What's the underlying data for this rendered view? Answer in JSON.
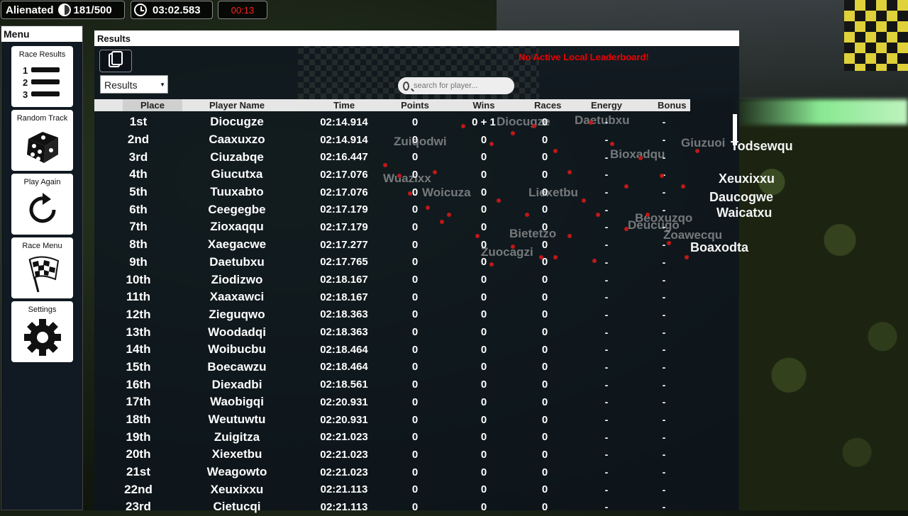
{
  "hud": {
    "player_name": "Alienated",
    "progress": "181/500",
    "race_time": "03:02.583",
    "countdown": "00:13"
  },
  "menu": {
    "title": "Menu",
    "buttons": [
      {
        "label": "Race Results",
        "icon": "podium-list-icon"
      },
      {
        "label": "Random Track",
        "icon": "dice-icon"
      },
      {
        "label": "Play Again",
        "icon": "refresh-icon"
      },
      {
        "label": "Race Menu",
        "icon": "checkered-flag-icon"
      },
      {
        "label": "Settings",
        "icon": "gear-icon"
      }
    ]
  },
  "results": {
    "title": "Results",
    "warning": "No Active Local Leaderboard!",
    "dropdown_value": "Results",
    "search_placeholder": "search for player...",
    "columns": [
      "Place",
      "Player Name",
      "Time",
      "Points",
      "Wins",
      "Races",
      "Energy",
      "Bonus"
    ],
    "rows": [
      [
        "1st",
        "Diocugze",
        "02:14.914",
        "0",
        "0 + 1",
        "0",
        "-",
        "-"
      ],
      [
        "2nd",
        "Caaxuxzo",
        "02:14.914",
        "0",
        "0",
        "0",
        "-",
        "-"
      ],
      [
        "3rd",
        "Ciuzabqe",
        "02:16.447",
        "0",
        "0",
        "0",
        "-",
        "-"
      ],
      [
        "4th",
        "Giucutxa",
        "02:17.076",
        "0",
        "0",
        "0",
        "-",
        "-"
      ],
      [
        "5th",
        "Tuuxabto",
        "02:17.076",
        "0",
        "0",
        "0",
        "-",
        "-"
      ],
      [
        "6th",
        "Ceegegbe",
        "02:17.179",
        "0",
        "0",
        "0",
        "-",
        "-"
      ],
      [
        "7th",
        "Zioxaqqu",
        "02:17.179",
        "0",
        "0",
        "0",
        "-",
        "-"
      ],
      [
        "8th",
        "Xaegacwe",
        "02:17.277",
        "0",
        "0",
        "0",
        "-",
        "-"
      ],
      [
        "9th",
        "Daetubxu",
        "02:17.765",
        "0",
        "0",
        "0",
        "-",
        "-"
      ],
      [
        "10th",
        "Ziodizwo",
        "02:18.167",
        "0",
        "0",
        "0",
        "-",
        "-"
      ],
      [
        "11th",
        "Xaaxawci",
        "02:18.167",
        "0",
        "0",
        "0",
        "-",
        "-"
      ],
      [
        "12th",
        "Zieguqwo",
        "02:18.363",
        "0",
        "0",
        "0",
        "-",
        "-"
      ],
      [
        "13th",
        "Woodadqi",
        "02:18.363",
        "0",
        "0",
        "0",
        "-",
        "-"
      ],
      [
        "14th",
        "Woibucbu",
        "02:18.464",
        "0",
        "0",
        "0",
        "-",
        "-"
      ],
      [
        "15th",
        "Boecawzu",
        "02:18.464",
        "0",
        "0",
        "0",
        "-",
        "-"
      ],
      [
        "16th",
        "Diexadbi",
        "02:18.561",
        "0",
        "0",
        "0",
        "-",
        "-"
      ],
      [
        "17th",
        "Waobigqi",
        "02:20.931",
        "0",
        "0",
        "0",
        "-",
        "-"
      ],
      [
        "18th",
        "Weutuwtu",
        "02:20.931",
        "0",
        "0",
        "0",
        "-",
        "-"
      ],
      [
        "19th",
        "Zuigitza",
        "02:21.023",
        "0",
        "0",
        "0",
        "-",
        "-"
      ],
      [
        "20th",
        "Xiexetbu",
        "02:21.023",
        "0",
        "0",
        "0",
        "-",
        "-"
      ],
      [
        "21st",
        "Weagowto",
        "02:21.023",
        "0",
        "0",
        "0",
        "-",
        "-"
      ],
      [
        "22nd",
        "Xeuxixxu",
        "02:21.113",
        "0",
        "0",
        "0",
        "-",
        "-"
      ],
      [
        "23rd",
        "Cietucqi",
        "02:21.113",
        "0",
        "0",
        "0",
        "-",
        "-"
      ]
    ]
  },
  "overlay_names": {
    "outside": [
      "Todsewqu",
      "Xeuxixxu",
      "Daucogwe",
      "Waicatxu",
      "Boaxodta"
    ],
    "ghost": [
      "Zuiqodwi",
      "Woicuza",
      "Bietetzo",
      "Zuocagzi",
      "Diocugze",
      "Bioxadqu",
      "Deucugo",
      "Zoawecqu",
      "Beoxuzqo",
      "Giuzuoi",
      "Wuazixx",
      "Daetubxu",
      "Liexetbu"
    ]
  }
}
